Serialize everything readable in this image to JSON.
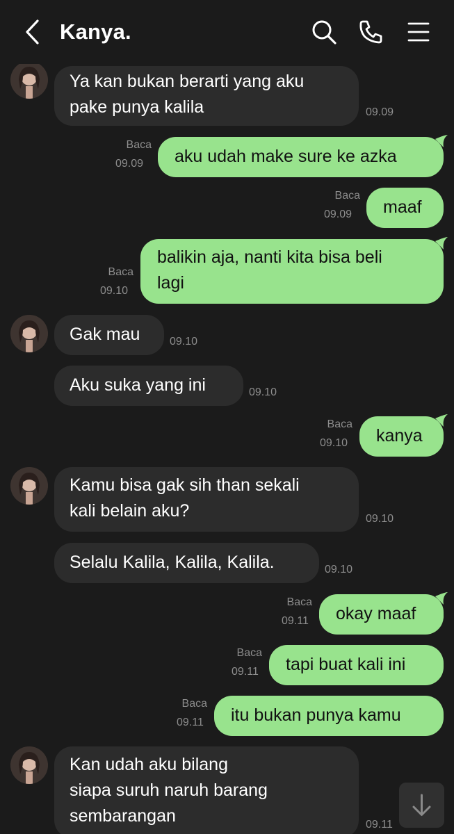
{
  "header": {
    "contact_name": "Kanya."
  },
  "messages": [
    {
      "from": "them",
      "lines": [
        "Ya kan bukan berarti yang aku",
        "pake punya kalila"
      ],
      "time": "09.09"
    },
    {
      "from": "me",
      "lines": [
        "aku udah make sure ke azka"
      ],
      "read": "Baca",
      "time": "09.09"
    },
    {
      "from": "me",
      "lines": [
        "maaf"
      ],
      "read": "Baca",
      "time": "09.09"
    },
    {
      "from": "me",
      "lines": [
        "balikin aja, nanti kita bisa beli",
        "lagi"
      ],
      "read": "Baca",
      "time": "09.10"
    },
    {
      "from": "them",
      "lines": [
        "Gak mau"
      ],
      "time": "09.10"
    },
    {
      "from": "them",
      "lines": [
        "Aku suka yang ini"
      ],
      "time": "09.10"
    },
    {
      "from": "me",
      "lines": [
        "kanya"
      ],
      "read": "Baca",
      "time": "09.10"
    },
    {
      "from": "them",
      "lines": [
        "Kamu bisa gak sih than sekali",
        "kali belain aku?"
      ],
      "time": "09.10"
    },
    {
      "from": "them",
      "lines": [
        "Selalu Kalila, Kalila, Kalila."
      ],
      "time": "09.10"
    },
    {
      "from": "me",
      "lines": [
        "okay maaf"
      ],
      "read": "Baca",
      "time": "09.11"
    },
    {
      "from": "me",
      "lines": [
        "tapi buat kali ini"
      ],
      "read": "Baca",
      "time": "09.11"
    },
    {
      "from": "me",
      "lines": [
        "itu bukan punya kamu"
      ],
      "read": "Baca",
      "time": "09.11"
    },
    {
      "from": "them",
      "lines": [
        "Kan udah aku bilang",
        "siapa suruh naruh barang",
        "sembarangan"
      ],
      "time": "09.11"
    }
  ],
  "icons": {
    "back": "chevron-left-icon",
    "search": "search-icon",
    "call": "phone-icon",
    "menu": "hamburger-menu-icon",
    "scroll": "arrow-down-icon"
  },
  "colors": {
    "background": "#1b1b1b",
    "incoming_bubble": "#2c2c2c",
    "outgoing_bubble": "#98e38d",
    "meta_text": "#8d8d8d"
  }
}
